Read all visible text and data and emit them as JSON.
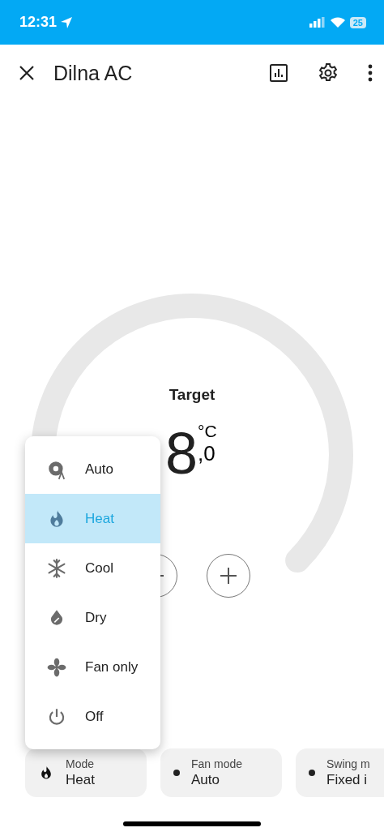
{
  "status_bar": {
    "time": "12:31",
    "battery": "25"
  },
  "header": {
    "title": "Dilna AC"
  },
  "dial": {
    "label": "Target",
    "value": "8",
    "unit": "°C",
    "decimal": ",0"
  },
  "mode_menu": [
    {
      "kind": "auto",
      "label": "Auto",
      "selected": false
    },
    {
      "kind": "heat",
      "label": "Heat",
      "selected": true
    },
    {
      "kind": "cool",
      "label": "Cool",
      "selected": false
    },
    {
      "kind": "dry",
      "label": "Dry",
      "selected": false
    },
    {
      "kind": "fan",
      "label": "Fan only",
      "selected": false
    },
    {
      "kind": "off",
      "label": "Off",
      "selected": false
    }
  ],
  "chips": [
    {
      "kind": "heat",
      "label": "Mode",
      "value": "Heat"
    },
    {
      "kind": "dot",
      "label": "Fan mode",
      "value": "Auto"
    },
    {
      "kind": "dot",
      "label": "Swing m",
      "value": "Fixed i"
    }
  ]
}
